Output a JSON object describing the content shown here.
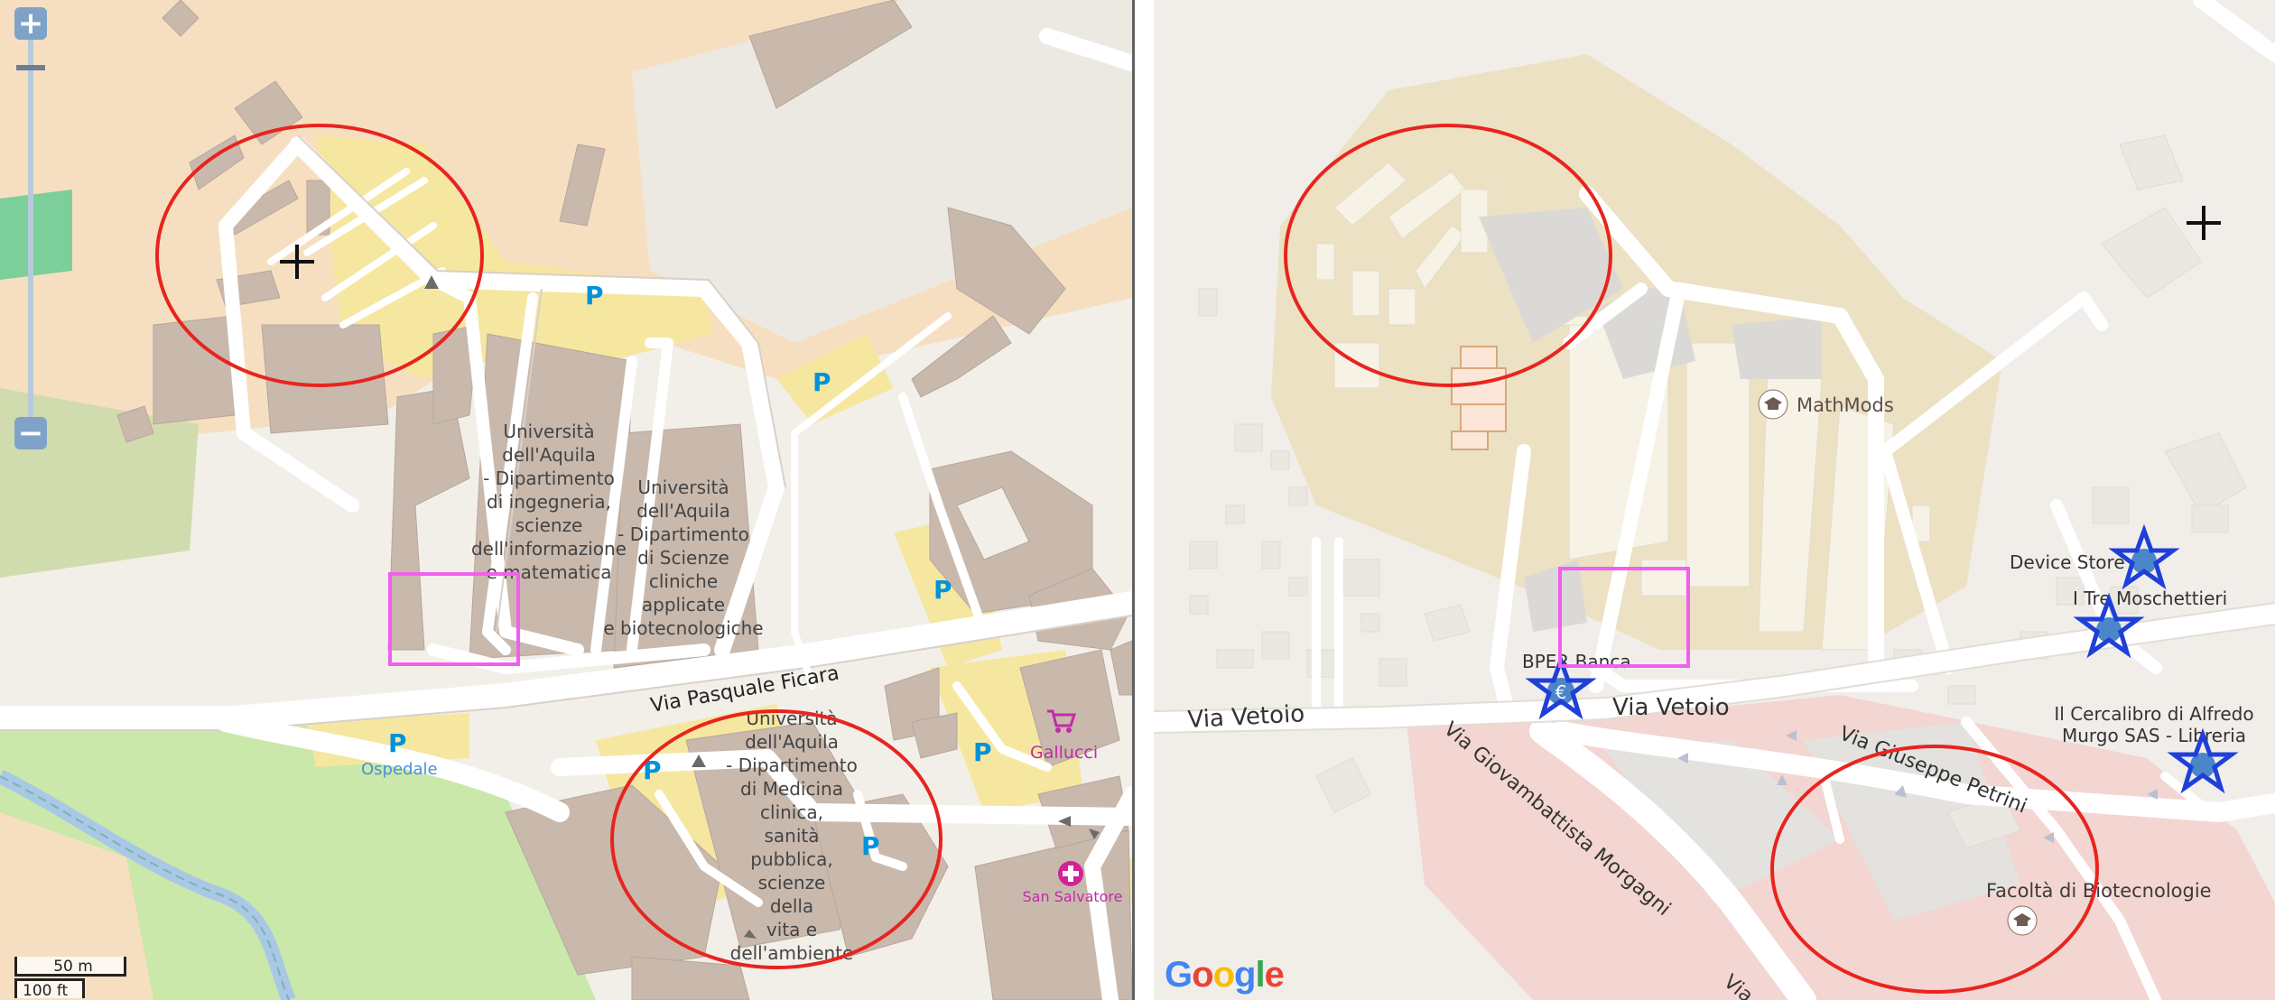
{
  "left_map": {
    "zoom": {
      "in_label": "+",
      "out_label": "−"
    },
    "labels": {
      "ingegneria": [
        "Università",
        "dell'Aquila",
        "- Dipartimento",
        "di ingegneria,",
        "scienze",
        "dell'informazione",
        "e matematica"
      ],
      "scienze_cliniche": [
        "Università",
        "dell'Aquila",
        "- Dipartimento",
        "di Scienze",
        "cliniche",
        "applicate",
        "e biotecnologiche"
      ],
      "medicina": [
        "Università",
        "dell'Aquila",
        "- Dipartimento",
        "di Medicina",
        "clinica,",
        "sanità",
        "pubblica,",
        "scienze",
        "della",
        "vita e",
        "dell'ambiente"
      ],
      "street": "Via Pasquale Ficara",
      "ospedale": "Ospedale",
      "gallucci": "Gallucci",
      "san_salvatore": "San Salvatore",
      "parking": "P"
    },
    "scale": {
      "metric": "50 m",
      "imperial": "100 ft"
    },
    "colors": {
      "road": "#ffffff",
      "building": "#c9b9ad",
      "parking": "#f6e7a0",
      "park": "#c8e6a8",
      "wood": "#add19e",
      "water": "#a8c8e6",
      "circle": "#e8241f",
      "rect": "#f25ef0"
    }
  },
  "right_map": {
    "labels": {
      "mathmods": "MathMods",
      "device_store": "Device Store",
      "tre_moschettieri": "I Tre Moschettieri",
      "cercalibro": [
        "Il Cercalibro di Alfredo",
        "Murgo SAS - Libreria"
      ],
      "bper": "BPER Banca",
      "via_vetoio_1": "Via Vetoio",
      "via_vetoio_2": "Via Vetoio",
      "via_petrini": "Via Giuseppe Petrini",
      "via_morgagni": "Via Giovambattista Morgagni",
      "via_partial": "Via",
      "facolta": "Facoltà di Biotecnologie",
      "google": "Google"
    },
    "google_colors": [
      "#4285f4",
      "#ea4335",
      "#fbbc05",
      "#4285f4",
      "#34a853",
      "#ea4335"
    ],
    "colors": {
      "campus": "#ece1c3",
      "building": "#f5f1e3",
      "hospital": "#f3d5d1",
      "star": "#1f3fd9",
      "circle": "#e8241f",
      "rect": "#f25ef0"
    }
  }
}
